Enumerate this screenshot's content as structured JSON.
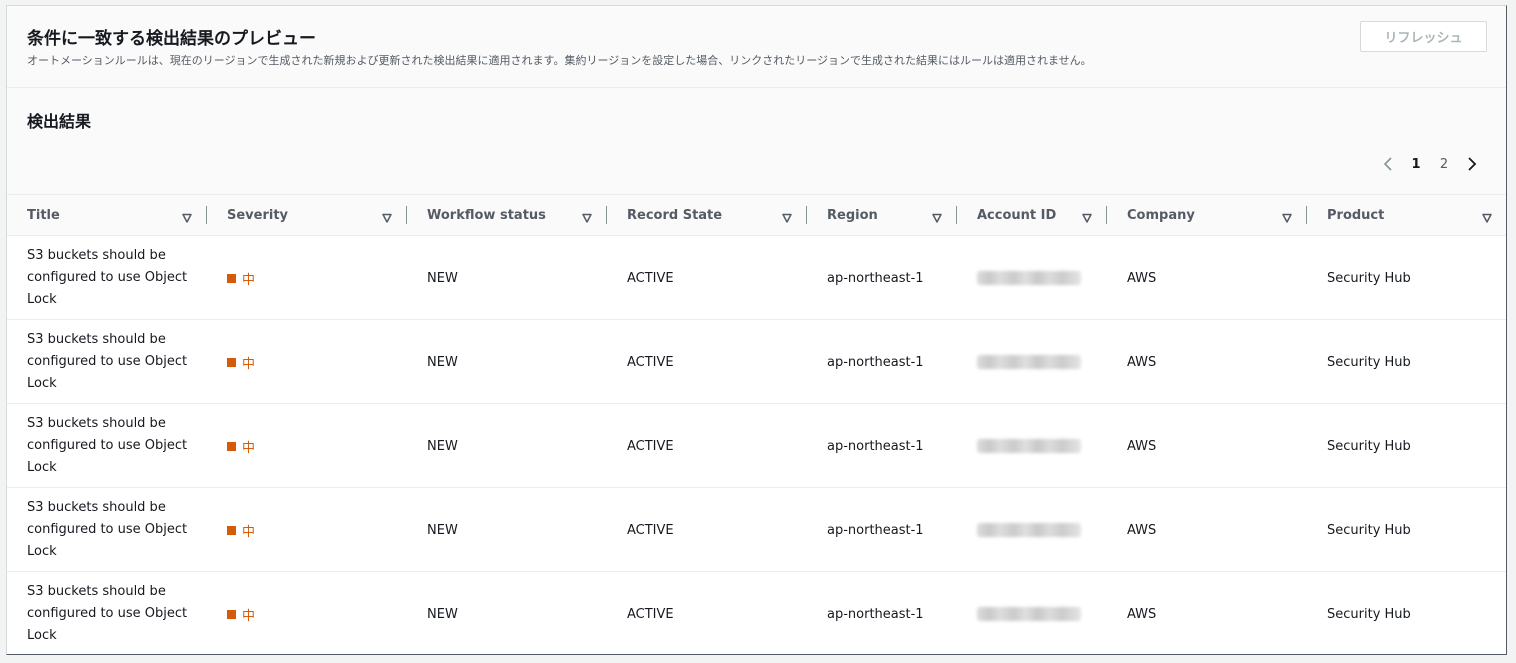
{
  "header": {
    "title": "条件に一致する検出結果のプレビュー",
    "description": "オートメーションルールは、現在のリージョンで生成された新規および更新された検出結果に適用されます。集約リージョンを設定した場合、リンクされたリージョンで生成された結果にはルールは適用されません。",
    "refresh_label": "リフレッシュ"
  },
  "results": {
    "title": "検出結果",
    "pagination": {
      "pages": [
        "1",
        "2"
      ],
      "current": "1"
    }
  },
  "table": {
    "columns": [
      "Title",
      "Severity",
      "Workflow status",
      "Record State",
      "Region",
      "Account ID",
      "Company",
      "Product"
    ],
    "rows": [
      {
        "title": "S3 buckets should be configured to use Object Lock",
        "severity": "中",
        "workflow": "NEW",
        "record_state": "ACTIVE",
        "region": "ap-northeast-1",
        "company": "AWS",
        "product": "Security Hub"
      },
      {
        "title": "S3 buckets should be configured to use Object Lock",
        "severity": "中",
        "workflow": "NEW",
        "record_state": "ACTIVE",
        "region": "ap-northeast-1",
        "company": "AWS",
        "product": "Security Hub"
      },
      {
        "title": "S3 buckets should be configured to use Object Lock",
        "severity": "中",
        "workflow": "NEW",
        "record_state": "ACTIVE",
        "region": "ap-northeast-1",
        "company": "AWS",
        "product": "Security Hub"
      },
      {
        "title": "S3 buckets should be configured to use Object Lock",
        "severity": "中",
        "workflow": "NEW",
        "record_state": "ACTIVE",
        "region": "ap-northeast-1",
        "company": "AWS",
        "product": "Security Hub"
      },
      {
        "title": "S3 buckets should be configured to use Object Lock",
        "severity": "中",
        "workflow": "NEW",
        "record_state": "ACTIVE",
        "region": "ap-northeast-1",
        "company": "AWS",
        "product": "Security Hub"
      }
    ]
  },
  "colors": {
    "severity_medium": "#d45b07",
    "text_primary": "#16191f",
    "text_secondary": "#545b64"
  },
  "icons": {
    "sort": "caret-down-icon",
    "prev": "chevron-left-icon",
    "next": "chevron-right-icon"
  }
}
